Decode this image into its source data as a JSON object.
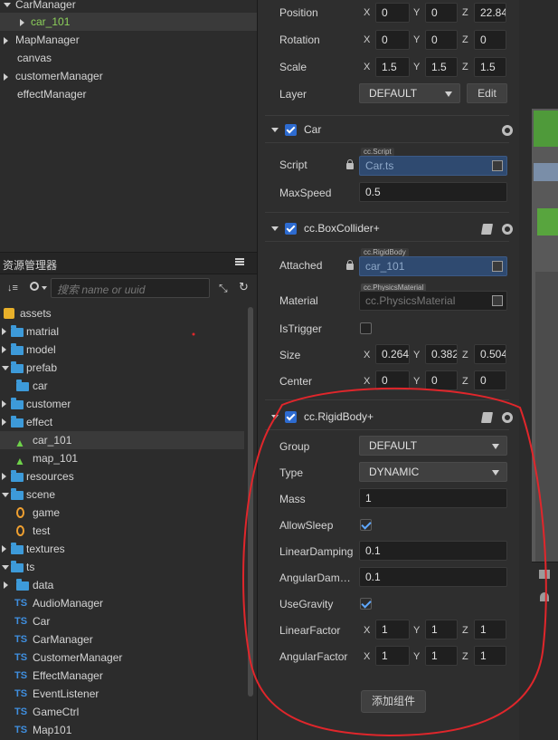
{
  "hierarchy": {
    "items": [
      {
        "label": "CarManager"
      },
      {
        "label": "car_101"
      },
      {
        "label": "MapManager"
      },
      {
        "label": "canvas"
      },
      {
        "label": "customerManager"
      },
      {
        "label": "effectManager"
      }
    ]
  },
  "assets_panel": {
    "title": "资源管理器",
    "menu_icon": "hamburger-icon",
    "search_placeholder": "搜索 name or uuid",
    "items": [
      {
        "label": "assets"
      },
      {
        "label": "matrial"
      },
      {
        "label": "model"
      },
      {
        "label": "prefab"
      },
      {
        "label": "car"
      },
      {
        "label": "customer"
      },
      {
        "label": "effect"
      },
      {
        "label": "car_101"
      },
      {
        "label": "map_101"
      },
      {
        "label": "resources"
      },
      {
        "label": "scene"
      },
      {
        "label": "game"
      },
      {
        "label": "test"
      },
      {
        "label": "textures"
      },
      {
        "label": "ts"
      },
      {
        "label": "data"
      },
      {
        "label": "AudioManager"
      },
      {
        "label": "Car"
      },
      {
        "label": "CarManager"
      },
      {
        "label": "CustomerManager"
      },
      {
        "label": "EffectManager"
      },
      {
        "label": "EventListener"
      },
      {
        "label": "GameCtrl"
      },
      {
        "label": "Map101"
      }
    ],
    "ts_badge": "TS"
  },
  "inspector": {
    "transform": {
      "position": {
        "label": "Position",
        "x": "0",
        "y": "0",
        "z": "22.84"
      },
      "rotation": {
        "label": "Rotation",
        "x": "0",
        "y": "0",
        "z": "0"
      },
      "scale": {
        "label": "Scale",
        "x": "1.5",
        "y": "1.5",
        "z": "1.5"
      },
      "layer": {
        "label": "Layer",
        "value": "DEFAULT",
        "edit_label": "Edit"
      }
    },
    "axis": {
      "x": "X",
      "y": "Y",
      "z": "Z"
    },
    "car": {
      "title": "Car",
      "script_label": "Script",
      "script_tag": "cc.Script",
      "script_value": "Car.ts",
      "maxspeed_label": "MaxSpeed",
      "maxspeed_value": "0.5"
    },
    "boxcollider": {
      "title": "cc.BoxCollider+",
      "attached_label": "Attached",
      "attached_tag": "cc.RigidBody",
      "attached_value": "car_101",
      "material_label": "Material",
      "material_tag": "cc.PhysicsMaterial",
      "material_value": "cc.PhysicsMaterial",
      "istrigger_label": "IsTrigger",
      "size": {
        "label": "Size",
        "x": "0.264",
        "y": "0.382",
        "z": "0.504"
      },
      "center": {
        "label": "Center",
        "x": "0",
        "y": "0",
        "z": "0"
      }
    },
    "rigidbody": {
      "title": "cc.RigidBody+",
      "group": {
        "label": "Group",
        "value": "DEFAULT"
      },
      "type": {
        "label": "Type",
        "value": "DYNAMIC"
      },
      "mass": {
        "label": "Mass",
        "value": "1"
      },
      "allowsleep_label": "AllowSleep",
      "lineardamping": {
        "label": "LinearDamping",
        "value": "0.1"
      },
      "angulardamping": {
        "label": "AngularDam…",
        "value": "0.1"
      },
      "usegravity_label": "UseGravity",
      "linearfactor": {
        "label": "LinearFactor",
        "x": "1",
        "y": "1",
        "z": "1"
      },
      "angularfactor": {
        "label": "AngularFactor",
        "x": "1",
        "y": "1",
        "z": "1"
      }
    },
    "add_component_label": "添加组件"
  },
  "colors": {
    "accent": "#2d6bd0",
    "selected_text": "#8cd05a",
    "annotation": "#e0262b"
  }
}
